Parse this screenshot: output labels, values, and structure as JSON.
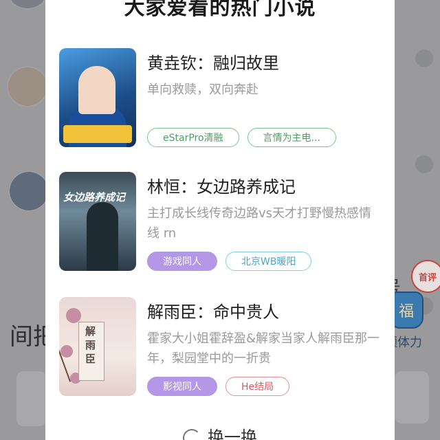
{
  "modal": {
    "title": "大家爱看的热门小说",
    "refresh_label": "换一换"
  },
  "books": [
    {
      "title": "黄垚钦：融归故里",
      "desc": "单向救赎，双向奔赴",
      "tags": [
        {
          "label": "eStarPro清融",
          "style": "green"
        },
        {
          "label": "言情为主电...",
          "style": "green"
        }
      ]
    },
    {
      "title": "林恒：女边路养成记",
      "desc": "主打成长线传奇边路vs天才打野慢热感情线   rn",
      "cover_text": "女边路养成记",
      "tags": [
        {
          "label": "游戏同人",
          "style": "purple"
        },
        {
          "label": "北京WB暖阳",
          "style": "cyan"
        }
      ]
    },
    {
      "title": "解雨臣：命中贵人",
      "desc": "霍家大小姐霍辞盈&解家当家人解雨臣那一年，梨园堂中的一折贵",
      "cover_text": "解雨臣",
      "tags": [
        {
          "label": "影视同人",
          "style": "purple"
        },
        {
          "label": "He结局",
          "style": "red"
        }
      ]
    }
  ],
  "background": {
    "left_text": "间把",
    "side_text": "号",
    "first_review_badge": "首评",
    "fu_label": "福",
    "stamina_label": "领体力"
  }
}
